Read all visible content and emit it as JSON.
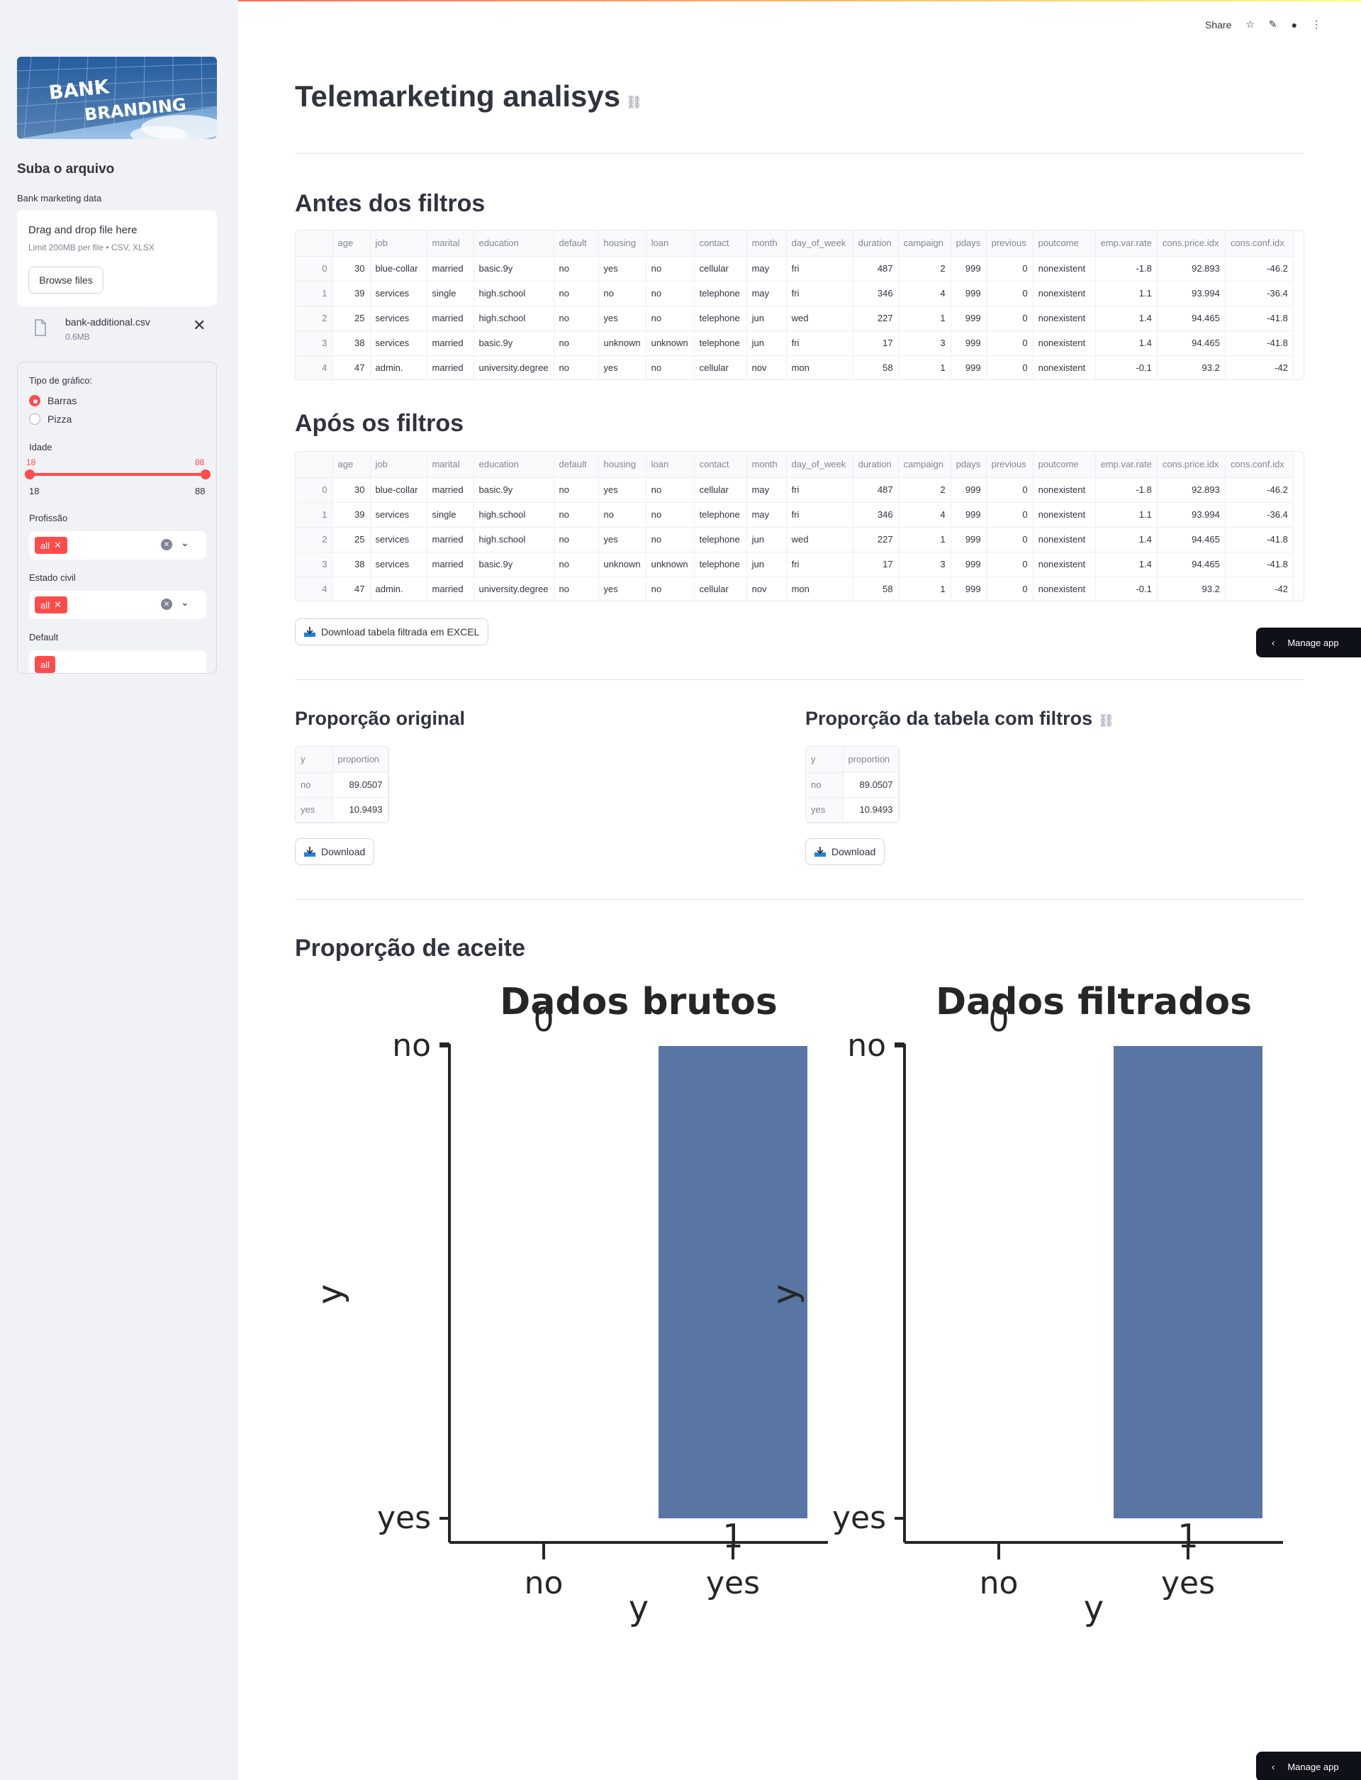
{
  "sidebar": {
    "logo_text_1": "BANK",
    "logo_text_2": "BRANDING",
    "heading": "Suba o arquivo",
    "uploader_label": "Bank marketing data",
    "dropzone_title": "Drag and drop file here",
    "dropzone_sub": "Limit 200MB per file • CSV, XLSX",
    "browse_label": "Browse files",
    "file_name": "bank-additional.csv",
    "file_size": "0.6MB",
    "chart_type_label": "Tipo de gráfico:",
    "radio_1": "Barras",
    "radio_2": "Pizza",
    "age_label": "Idade",
    "age_min": "18",
    "age_max": "88",
    "age_low": "18",
    "age_high": "88",
    "profession_label": "Profissão",
    "profession_tag": "all",
    "civil_label": "Estado civil",
    "civil_tag": "all",
    "default_label": "Default"
  },
  "header": {
    "share": "Share"
  },
  "main": {
    "title": "Telemarketing analisys",
    "before_heading": "Antes dos filtros",
    "after_heading": "Após os filtros",
    "excel_button": "Download tabela filtrada em EXCEL",
    "prop_original_heading": "Proporção original",
    "prop_filtered_heading": "Proporção da tabela com filtros",
    "download_label": "Download",
    "acceptance_heading": "Proporção de aceite",
    "manage_app": "Manage app"
  },
  "table": {
    "columns": [
      "age",
      "job",
      "marital",
      "education",
      "default",
      "housing",
      "loan",
      "contact",
      "month",
      "day_of_week",
      "duration",
      "campaign",
      "pdays",
      "previous",
      "poutcome",
      "emp.var.rate",
      "cons.price.idx",
      "cons.conf.idx"
    ],
    "rows": [
      [
        "0",
        "30",
        "blue-collar",
        "married",
        "basic.9y",
        "no",
        "yes",
        "no",
        "cellular",
        "may",
        "fri",
        "487",
        "2",
        "999",
        "0",
        "nonexistent",
        "-1.8",
        "92.893",
        "-46.2"
      ],
      [
        "1",
        "39",
        "services",
        "single",
        "high.school",
        "no",
        "no",
        "no",
        "telephone",
        "may",
        "fri",
        "346",
        "4",
        "999",
        "0",
        "nonexistent",
        "1.1",
        "93.994",
        "-36.4"
      ],
      [
        "2",
        "25",
        "services",
        "married",
        "high.school",
        "no",
        "yes",
        "no",
        "telephone",
        "jun",
        "wed",
        "227",
        "1",
        "999",
        "0",
        "nonexistent",
        "1.4",
        "94.465",
        "-41.8"
      ],
      [
        "3",
        "38",
        "services",
        "married",
        "basic.9y",
        "no",
        "unknown",
        "unknown",
        "telephone",
        "jun",
        "fri",
        "17",
        "3",
        "999",
        "0",
        "nonexistent",
        "1.4",
        "94.465",
        "-41.8"
      ],
      [
        "4",
        "47",
        "admin.",
        "married",
        "university.degree",
        "no",
        "yes",
        "no",
        "cellular",
        "nov",
        "mon",
        "58",
        "1",
        "999",
        "0",
        "nonexistent",
        "-0.1",
        "93.2",
        "-42"
      ]
    ]
  },
  "proportion": {
    "columns": [
      "y",
      "proportion"
    ],
    "rows": [
      [
        "no",
        "89.0507"
      ],
      [
        "yes",
        "10.9493"
      ]
    ]
  },
  "chart_data": [
    {
      "type": "bar",
      "title": "Dados brutos",
      "xlabel": "y",
      "ylabel": "y",
      "x_ticks": [
        "no",
        "yes"
      ],
      "y_ticks": [
        "no",
        "yes"
      ],
      "overlay_numbers": [
        "0",
        "1"
      ],
      "bars": [
        {
          "x": "yes",
          "y_from": "no",
          "y_to": "yes"
        }
      ],
      "color": "#5975a4"
    },
    {
      "type": "bar",
      "title": "Dados filtrados",
      "xlabel": "y",
      "ylabel": "y",
      "x_ticks": [
        "no",
        "yes"
      ],
      "y_ticks": [
        "no",
        "yes"
      ],
      "overlay_numbers": [
        "0",
        "1"
      ],
      "bars": [
        {
          "x": "yes",
          "y_from": "no",
          "y_to": "yes"
        }
      ],
      "color": "#5975a4"
    }
  ],
  "colors": {
    "accent": "#ff4b4b",
    "bar": "#5975a4",
    "sidebar_bg": "#f0f2f6",
    "dark_button": "#0e1117"
  }
}
